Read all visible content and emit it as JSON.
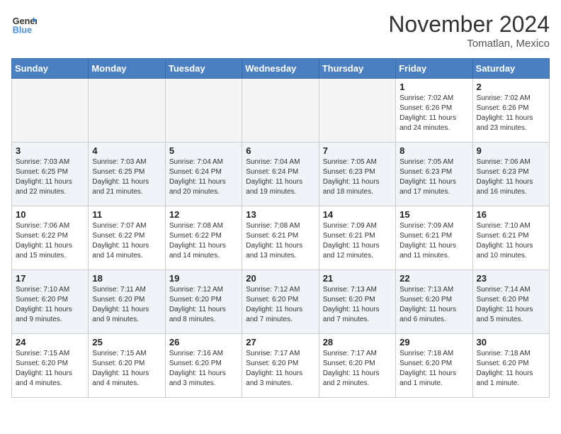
{
  "header": {
    "logo_line1": "General",
    "logo_line2": "Blue",
    "month": "November 2024",
    "location": "Tomatlan, Mexico"
  },
  "weekdays": [
    "Sunday",
    "Monday",
    "Tuesday",
    "Wednesday",
    "Thursday",
    "Friday",
    "Saturday"
  ],
  "weeks": [
    [
      {
        "day": "",
        "empty": true
      },
      {
        "day": "",
        "empty": true
      },
      {
        "day": "",
        "empty": true
      },
      {
        "day": "",
        "empty": true
      },
      {
        "day": "",
        "empty": true
      },
      {
        "day": "1",
        "sunrise": "Sunrise: 7:02 AM",
        "sunset": "Sunset: 6:26 PM",
        "daylight": "Daylight: 11 hours and 24 minutes."
      },
      {
        "day": "2",
        "sunrise": "Sunrise: 7:02 AM",
        "sunset": "Sunset: 6:26 PM",
        "daylight": "Daylight: 11 hours and 23 minutes."
      }
    ],
    [
      {
        "day": "3",
        "sunrise": "Sunrise: 7:03 AM",
        "sunset": "Sunset: 6:25 PM",
        "daylight": "Daylight: 11 hours and 22 minutes."
      },
      {
        "day": "4",
        "sunrise": "Sunrise: 7:03 AM",
        "sunset": "Sunset: 6:25 PM",
        "daylight": "Daylight: 11 hours and 21 minutes."
      },
      {
        "day": "5",
        "sunrise": "Sunrise: 7:04 AM",
        "sunset": "Sunset: 6:24 PM",
        "daylight": "Daylight: 11 hours and 20 minutes."
      },
      {
        "day": "6",
        "sunrise": "Sunrise: 7:04 AM",
        "sunset": "Sunset: 6:24 PM",
        "daylight": "Daylight: 11 hours and 19 minutes."
      },
      {
        "day": "7",
        "sunrise": "Sunrise: 7:05 AM",
        "sunset": "Sunset: 6:23 PM",
        "daylight": "Daylight: 11 hours and 18 minutes."
      },
      {
        "day": "8",
        "sunrise": "Sunrise: 7:05 AM",
        "sunset": "Sunset: 6:23 PM",
        "daylight": "Daylight: 11 hours and 17 minutes."
      },
      {
        "day": "9",
        "sunrise": "Sunrise: 7:06 AM",
        "sunset": "Sunset: 6:23 PM",
        "daylight": "Daylight: 11 hours and 16 minutes."
      }
    ],
    [
      {
        "day": "10",
        "sunrise": "Sunrise: 7:06 AM",
        "sunset": "Sunset: 6:22 PM",
        "daylight": "Daylight: 11 hours and 15 minutes."
      },
      {
        "day": "11",
        "sunrise": "Sunrise: 7:07 AM",
        "sunset": "Sunset: 6:22 PM",
        "daylight": "Daylight: 11 hours and 14 minutes."
      },
      {
        "day": "12",
        "sunrise": "Sunrise: 7:08 AM",
        "sunset": "Sunset: 6:22 PM",
        "daylight": "Daylight: 11 hours and 14 minutes."
      },
      {
        "day": "13",
        "sunrise": "Sunrise: 7:08 AM",
        "sunset": "Sunset: 6:21 PM",
        "daylight": "Daylight: 11 hours and 13 minutes."
      },
      {
        "day": "14",
        "sunrise": "Sunrise: 7:09 AM",
        "sunset": "Sunset: 6:21 PM",
        "daylight": "Daylight: 11 hours and 12 minutes."
      },
      {
        "day": "15",
        "sunrise": "Sunrise: 7:09 AM",
        "sunset": "Sunset: 6:21 PM",
        "daylight": "Daylight: 11 hours and 11 minutes."
      },
      {
        "day": "16",
        "sunrise": "Sunrise: 7:10 AM",
        "sunset": "Sunset: 6:21 PM",
        "daylight": "Daylight: 11 hours and 10 minutes."
      }
    ],
    [
      {
        "day": "17",
        "sunrise": "Sunrise: 7:10 AM",
        "sunset": "Sunset: 6:20 PM",
        "daylight": "Daylight: 11 hours and 9 minutes."
      },
      {
        "day": "18",
        "sunrise": "Sunrise: 7:11 AM",
        "sunset": "Sunset: 6:20 PM",
        "daylight": "Daylight: 11 hours and 9 minutes."
      },
      {
        "day": "19",
        "sunrise": "Sunrise: 7:12 AM",
        "sunset": "Sunset: 6:20 PM",
        "daylight": "Daylight: 11 hours and 8 minutes."
      },
      {
        "day": "20",
        "sunrise": "Sunrise: 7:12 AM",
        "sunset": "Sunset: 6:20 PM",
        "daylight": "Daylight: 11 hours and 7 minutes."
      },
      {
        "day": "21",
        "sunrise": "Sunrise: 7:13 AM",
        "sunset": "Sunset: 6:20 PM",
        "daylight": "Daylight: 11 hours and 7 minutes."
      },
      {
        "day": "22",
        "sunrise": "Sunrise: 7:13 AM",
        "sunset": "Sunset: 6:20 PM",
        "daylight": "Daylight: 11 hours and 6 minutes."
      },
      {
        "day": "23",
        "sunrise": "Sunrise: 7:14 AM",
        "sunset": "Sunset: 6:20 PM",
        "daylight": "Daylight: 11 hours and 5 minutes."
      }
    ],
    [
      {
        "day": "24",
        "sunrise": "Sunrise: 7:15 AM",
        "sunset": "Sunset: 6:20 PM",
        "daylight": "Daylight: 11 hours and 4 minutes."
      },
      {
        "day": "25",
        "sunrise": "Sunrise: 7:15 AM",
        "sunset": "Sunset: 6:20 PM",
        "daylight": "Daylight: 11 hours and 4 minutes."
      },
      {
        "day": "26",
        "sunrise": "Sunrise: 7:16 AM",
        "sunset": "Sunset: 6:20 PM",
        "daylight": "Daylight: 11 hours and 3 minutes."
      },
      {
        "day": "27",
        "sunrise": "Sunrise: 7:17 AM",
        "sunset": "Sunset: 6:20 PM",
        "daylight": "Daylight: 11 hours and 3 minutes."
      },
      {
        "day": "28",
        "sunrise": "Sunrise: 7:17 AM",
        "sunset": "Sunset: 6:20 PM",
        "daylight": "Daylight: 11 hours and 2 minutes."
      },
      {
        "day": "29",
        "sunrise": "Sunrise: 7:18 AM",
        "sunset": "Sunset: 6:20 PM",
        "daylight": "Daylight: 11 hours and 1 minute."
      },
      {
        "day": "30",
        "sunrise": "Sunrise: 7:18 AM",
        "sunset": "Sunset: 6:20 PM",
        "daylight": "Daylight: 11 hours and 1 minute."
      }
    ]
  ]
}
